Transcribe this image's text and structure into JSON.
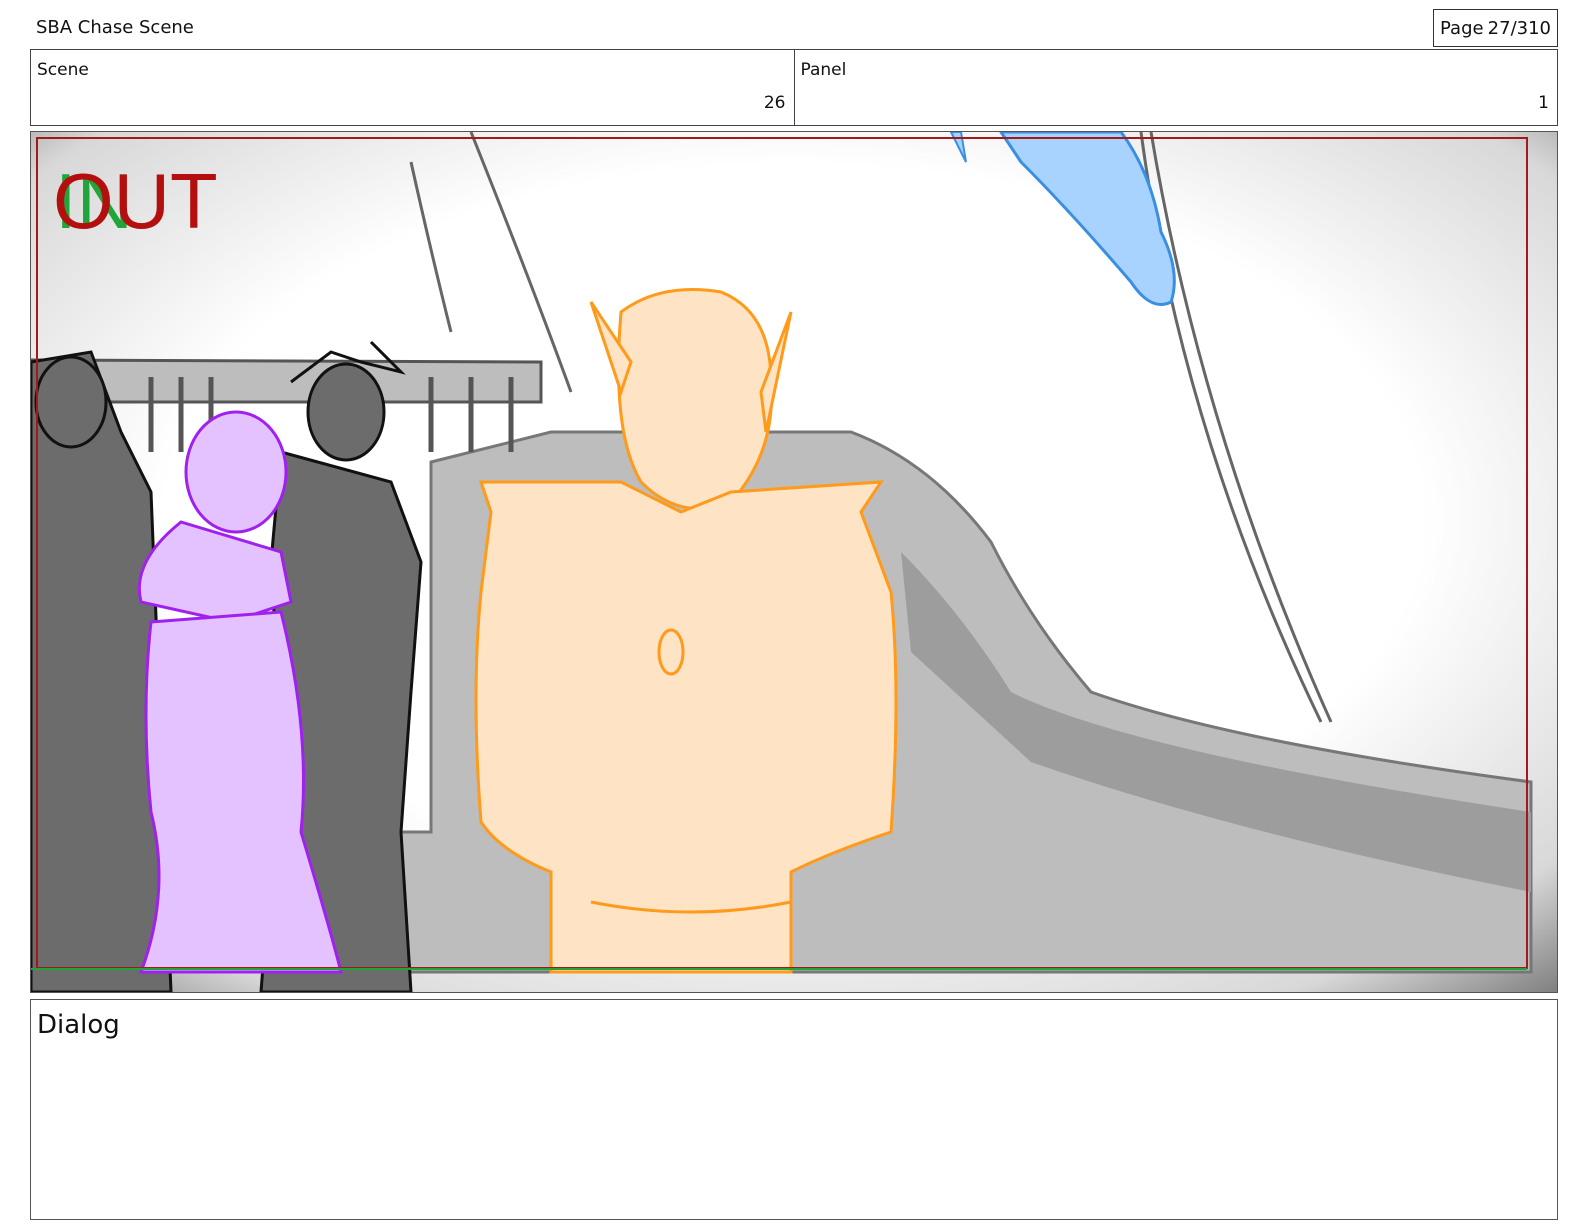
{
  "header": {
    "title": "SBA Chase Scene",
    "page_label": "Page",
    "page_value": "27/310"
  },
  "info": {
    "scene_label": "Scene",
    "scene_value": "26",
    "panel_label": "Panel",
    "panel_value": "1"
  },
  "panel": {
    "in_marker": "IN",
    "out_marker": "OUT",
    "colors": {
      "in_marker": "#1fa53a",
      "out_marker": "#b30f0f",
      "frame_border": "#a31818",
      "figure_orange": "#ff9a1a",
      "figure_purple": "#a020f0",
      "figure_blue": "#3a8fe0",
      "background_gray": "#9d9d9d"
    }
  },
  "dialog": {
    "label": "Dialog"
  }
}
